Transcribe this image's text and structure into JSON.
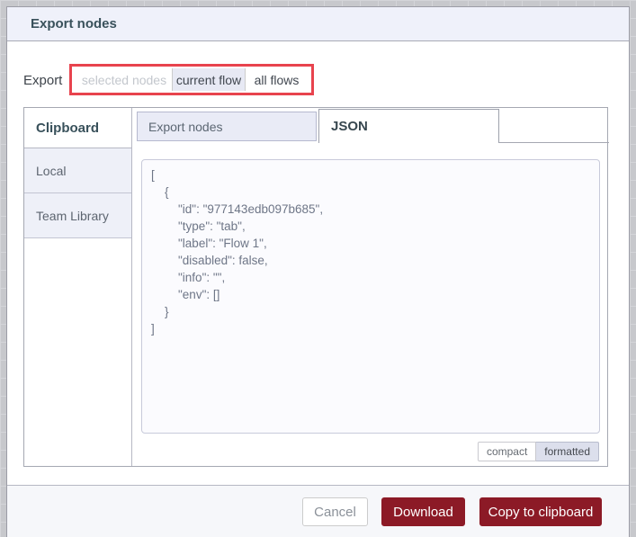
{
  "dialog": {
    "title": "Export nodes",
    "export_row": {
      "label": "Export",
      "options": [
        {
          "label": "selected nodes",
          "state": "disabled"
        },
        {
          "label": "current flow",
          "state": "selected"
        },
        {
          "label": "all flows",
          "state": "normal"
        }
      ]
    },
    "tabs": {
      "clipboard": "Clipboard",
      "export_nodes": "Export nodes",
      "json": "JSON",
      "active": "JSON"
    },
    "sidebar": {
      "items": [
        {
          "label": "Local"
        },
        {
          "label": "Team Library"
        }
      ]
    },
    "json_text": "[\n    {\n        \"id\": \"977143edb097b685\",\n        \"type\": \"tab\",\n        \"label\": \"Flow 1\",\n        \"disabled\": false,\n        \"info\": \"\",\n        \"env\": []\n    }\n]",
    "format_toggle": {
      "compact": "compact",
      "formatted": "formatted",
      "selected": "formatted"
    },
    "footer": {
      "cancel": "Cancel",
      "download": "Download",
      "copy": "Copy to clipboard"
    }
  },
  "colors": {
    "primary_button": "#8c1a26",
    "annotation_highlight": "#e8434e",
    "header_background": "#eff1fa",
    "selected_option_background": "#e7e9f4",
    "json_text_color": "#6e7687"
  }
}
